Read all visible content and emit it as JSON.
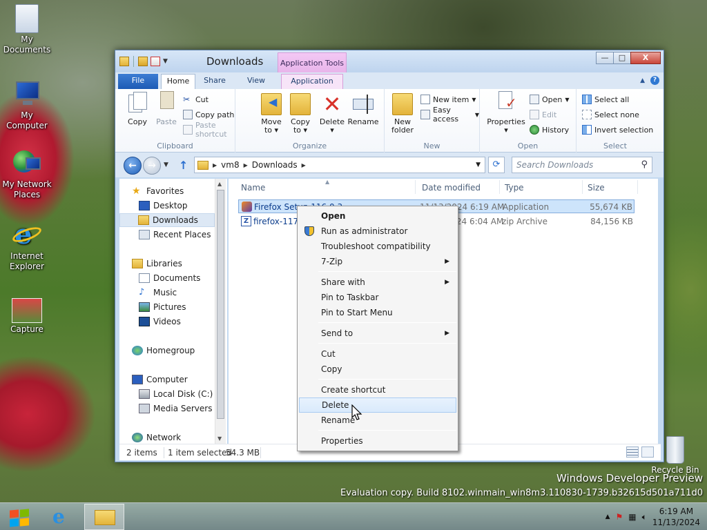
{
  "desktop": {
    "icons": [
      {
        "label": "My Documents"
      },
      {
        "label": "My Computer"
      },
      {
        "label": "My Network Places"
      },
      {
        "label": "Internet Explorer"
      },
      {
        "label": "Capture"
      }
    ],
    "recycle_bin": "Recycle Bin",
    "watermark_line1": "Windows Developer Preview",
    "watermark_line2": "Evaluation copy. Build 8102.winmain_win8m3.110830-1739.b32615d501a711d0"
  },
  "window": {
    "title": "Downloads",
    "contextual_tab_group": "Application Tools",
    "buttons": {
      "minimize": "—",
      "maximize": "□",
      "close": "X"
    }
  },
  "ribbon": {
    "tabs": [
      "File",
      "Home",
      "Share",
      "View",
      "Application"
    ],
    "active_tab": "Home",
    "clipboard": {
      "label": "Clipboard",
      "copy": "Copy",
      "paste": "Paste",
      "cut": "Cut",
      "copy_path": "Copy path",
      "paste_shortcut": "Paste shortcut"
    },
    "organize": {
      "label": "Organize",
      "move_to_1": "Move",
      "move_to_2": "to",
      "copy_to_1": "Copy",
      "copy_to_2": "to",
      "delete": "Delete",
      "rename": "Rename"
    },
    "new": {
      "label": "New",
      "new_folder_1": "New",
      "new_folder_2": "folder",
      "new_item": "New item",
      "easy_access": "Easy access"
    },
    "open": {
      "label": "Open",
      "properties": "Properties",
      "open": "Open",
      "edit": "Edit",
      "history": "History"
    },
    "select": {
      "label": "Select",
      "select_all": "Select all",
      "select_none": "Select none",
      "invert_selection": "Invert selection"
    }
  },
  "address": {
    "crumbs": [
      "vm8",
      "Downloads"
    ],
    "search_placeholder": "Search Downloads"
  },
  "nav": {
    "favorites": "Favorites",
    "desktop": "Desktop",
    "downloads": "Downloads",
    "recent_places": "Recent Places",
    "libraries": "Libraries",
    "documents": "Documents",
    "music": "Music",
    "pictures": "Pictures",
    "videos": "Videos",
    "homegroup": "Homegroup",
    "computer": "Computer",
    "local_disk": "Local Disk (C:)",
    "media_servers": "Media Servers",
    "network": "Network"
  },
  "files": {
    "columns": {
      "name": "Name",
      "date": "Date modified",
      "type": "Type",
      "size": "Size"
    },
    "rows": [
      {
        "name": "Firefox Setup 116.0.3",
        "date": "11/13/2024 6:19 AM",
        "type": "Application",
        "size": "55,674 KB"
      },
      {
        "name": "firefox-117.0",
        "date": "11/13/2024 6:04 AM",
        "type": "zip Archive",
        "size": "84,156 KB"
      }
    ]
  },
  "status": {
    "count": "2 items",
    "selection": "1 item selected",
    "size": "54.3 MB"
  },
  "context_menu": {
    "open": "Open",
    "run_as_admin": "Run as administrator",
    "troubleshoot": "Troubleshoot compatibility",
    "seven_zip": "7-Zip",
    "share_with": "Share with",
    "pin_taskbar": "Pin to Taskbar",
    "pin_start": "Pin to Start Menu",
    "send_to": "Send to",
    "cut": "Cut",
    "copy": "Copy",
    "create_shortcut": "Create shortcut",
    "delete": "Delete",
    "rename": "Rename",
    "properties": "Properties",
    "highlighted": "Delete"
  },
  "taskbar": {
    "time": "6:19 AM",
    "date": "11/13/2024"
  }
}
